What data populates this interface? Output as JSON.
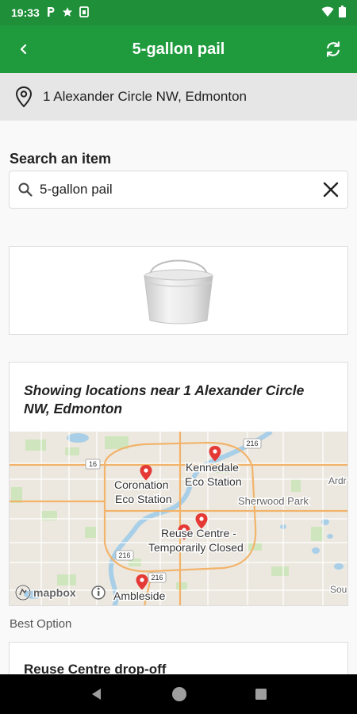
{
  "status_bar": {
    "time": "19:33",
    "icons": [
      "parking-icon",
      "star-icon",
      "sim-icon",
      "wifi-icon",
      "battery-icon"
    ]
  },
  "app_bar": {
    "title": "5-gallon pail",
    "back_icon": "back-arrow-icon",
    "refresh_icon": "refresh-icon"
  },
  "address_bar": {
    "address": "1 Alexander Circle NW, Edmonton",
    "icon": "location-pin-icon"
  },
  "search": {
    "heading": "Search an item",
    "value": "5-gallon pail",
    "clear_icon": "close-icon"
  },
  "item_image": {
    "icon": "pail-image"
  },
  "map_card": {
    "heading": "Showing locations near 1 Alexander Circle NW, Edmonton",
    "map": {
      "places": [
        "Coronation Eco Station",
        "Kennedale Eco Station",
        "Reuse Centre - Temporarily Closed",
        "Ambleside"
      ],
      "labels": {
        "coronation_1": "Coronation",
        "coronation_2": "Eco Station",
        "kennedale_1": "Kennedale",
        "kennedale_2": "Eco Station",
        "reuse_1": "Reuse Centre -",
        "reuse_2": "Temporarily Closed",
        "ambleside": "Ambleside",
        "sherwood": "Sherwood Park",
        "ardr": "Ardr",
        "sou": "Sou",
        "road_16": "16",
        "road_216_top": "216",
        "road_216_left": "216",
        "road_216_bottom": "216",
        "mapbox": "mapbox"
      }
    }
  },
  "best_option": {
    "label": "Best Option",
    "title": "Reuse Centre drop-off"
  },
  "nav_bar": {
    "icons": [
      "back-triangle-icon",
      "home-circle-icon",
      "recents-square-icon"
    ]
  },
  "colors": {
    "primary": "#1f9a3d",
    "status_bar": "#1f8f3a",
    "address_bg": "#e6e6e6",
    "pin": "#e53935"
  }
}
